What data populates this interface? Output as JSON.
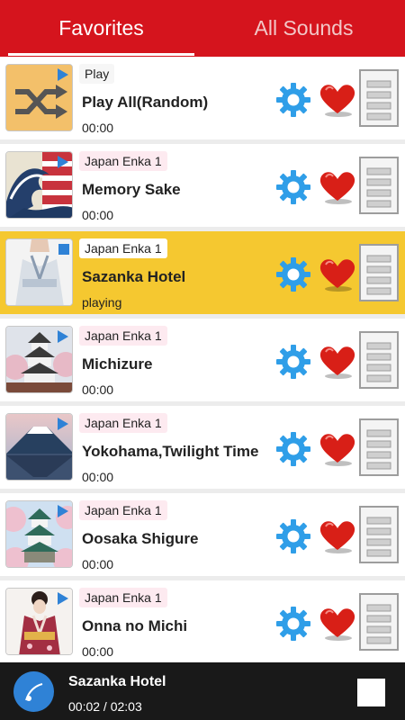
{
  "tabs": {
    "favorites": "Favorites",
    "all_sounds": "All Sounds"
  },
  "list": {
    "items": [
      {
        "tag": "Play",
        "title": "Play All(Random)",
        "time": "00:00"
      },
      {
        "tag": "Japan Enka 1",
        "title": "Memory Sake",
        "time": "00:00"
      },
      {
        "tag": "Japan Enka 1",
        "title": "Sazanka Hotel",
        "time": "playing"
      },
      {
        "tag": "Japan Enka 1",
        "title": "Michizure",
        "time": "00:00"
      },
      {
        "tag": "Japan Enka 1",
        "title": "Yokohama,Twilight Time",
        "time": "00:00"
      },
      {
        "tag": "Japan Enka 1",
        "title": "Oosaka Shigure",
        "time": "00:00"
      },
      {
        "tag": "Japan Enka 1",
        "title": "Onna no Michi",
        "time": "00:00"
      }
    ]
  },
  "player": {
    "title": "Sazanka Hotel",
    "time": "00:02 / 02:03"
  },
  "colors": {
    "header": "#d5141d",
    "active_row": "#f5c830",
    "player_bg": "#191919",
    "gear": "#2f9ee8",
    "heart": "#e0241c",
    "accent_blue": "#2f82d6"
  },
  "icons": [
    "shuffle-icon",
    "play-badge-icon",
    "gear-icon",
    "heart-icon",
    "document-icon",
    "disc-icon",
    "stop-icon"
  ]
}
